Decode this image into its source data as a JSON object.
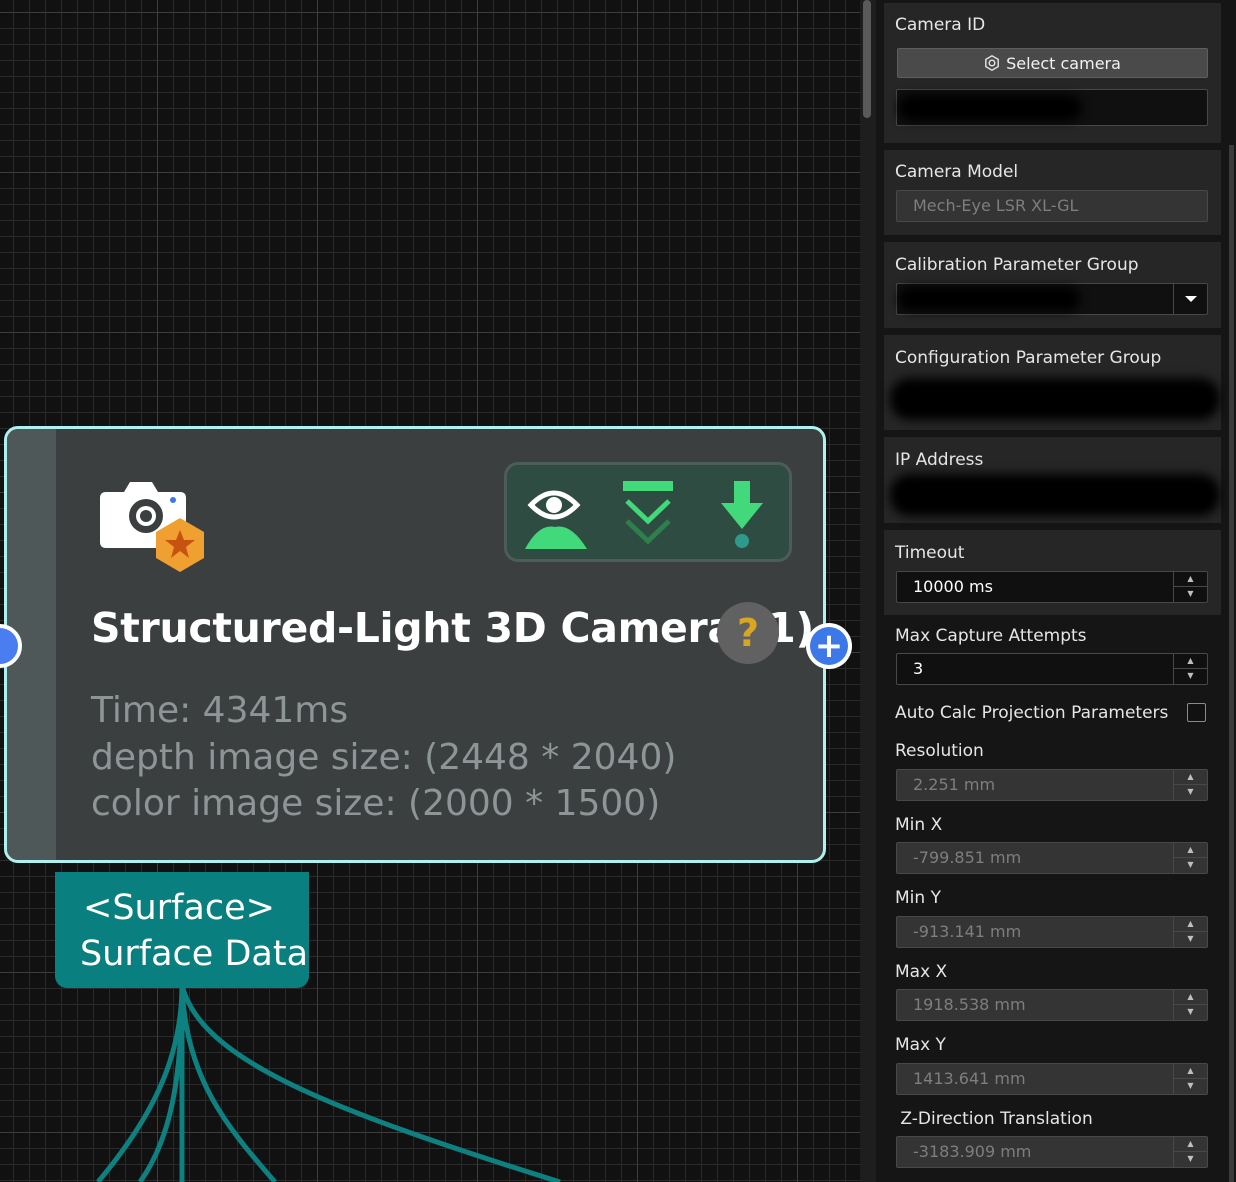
{
  "node": {
    "title": "Structured-Light 3D Camera (1)",
    "help": "?",
    "info": {
      "time": "Time: 4341ms",
      "depth": "depth image size: (2448 * 2040)",
      "color": "color image size: (2000 * 1500)"
    },
    "output_port": {
      "type": "<Surface>",
      "name": "Surface Data"
    },
    "add_port_symbol": "+",
    "toolbar_icons": [
      "eye-mountain-icon",
      "collapse-chevrons-icon",
      "download-arrow-icon"
    ],
    "icon": "camera-star-icon"
  },
  "panel": {
    "camera_id": {
      "label": "Camera ID",
      "button": "Select camera",
      "button_icon": "camera-gear-icon",
      "value": ""
    },
    "camera_model": {
      "label": "Camera Model",
      "value": "Mech-Eye LSR XL-GL"
    },
    "calibration": {
      "label": "Calibration Parameter Group",
      "value": ""
    },
    "configuration": {
      "label": "Configuration Parameter Group",
      "value": ""
    },
    "ip": {
      "label": "IP Address",
      "value": ""
    },
    "timeout": {
      "label": "Timeout",
      "value": "10000 ms"
    },
    "max_capture": {
      "label": "Max Capture Attempts",
      "value": "3"
    },
    "auto_calc": {
      "label": "Auto Calc Projection Parameters",
      "checked": false
    },
    "resolution": {
      "label": "Resolution",
      "value": "2.251 mm"
    },
    "min_x": {
      "label": "Min X",
      "value": "-799.851 mm"
    },
    "min_y": {
      "label": "Min Y",
      "value": "-913.141 mm"
    },
    "max_x": {
      "label": "Max X",
      "value": "1918.538 mm"
    },
    "max_y": {
      "label": "Max Y",
      "value": "1413.641 mm"
    },
    "z_translation": {
      "label": " Z-Direction Translation",
      "value": "-3183.909 mm"
    }
  },
  "colors": {
    "node_border": "#aef1ee",
    "output_port": "#0a7f7f",
    "toolbar_green": "#41d97a",
    "port_blue": "#3c78e8"
  }
}
